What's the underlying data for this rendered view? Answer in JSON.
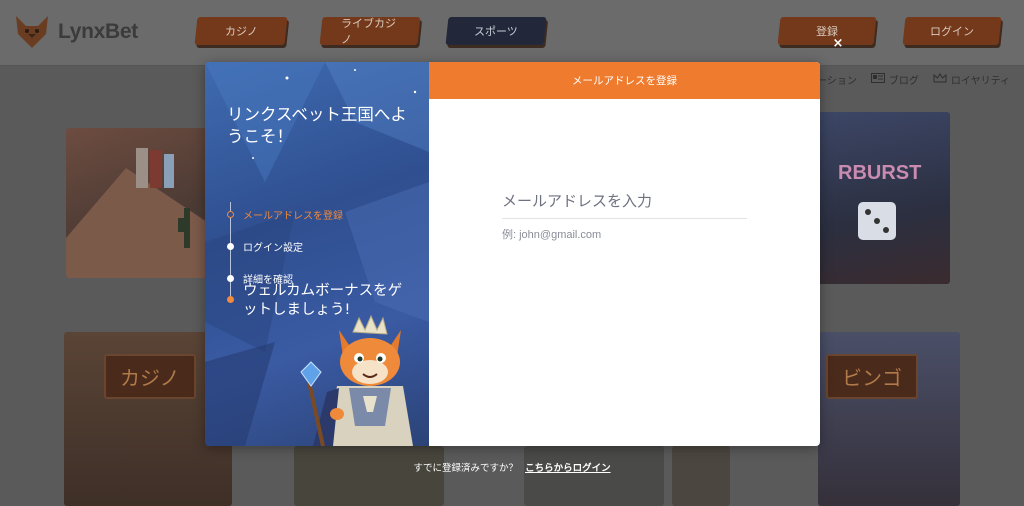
{
  "header": {
    "logo_text": "LynxBet",
    "nav": [
      "カジノ",
      "ライブカジノ",
      "スポーツ"
    ],
    "register_label": "登録",
    "login_label": "ログイン"
  },
  "subnav": {
    "promotion_partial": "ーション",
    "blog": "ブログ",
    "loyalty": "ロイヤリティ"
  },
  "background": {
    "casino_label": "カジノ",
    "bingo_label": "ビンゴ",
    "starburst_partial": "RBURST"
  },
  "modal": {
    "welcome_title": "リンクスベット王国へようこそ！",
    "steps": [
      {
        "label": "メールアドレスを登録",
        "active": true
      },
      {
        "label": "ログイン設定",
        "active": false
      },
      {
        "label": "詳細を確認",
        "active": false
      }
    ],
    "promo_text": "ウェルカムボーナスをゲットしましょう!",
    "form_header": "メールアドレスを登録",
    "email_label": "メールアドレスを入力",
    "email_placeholder": "例: john@gmail.com",
    "email_value": ""
  },
  "close_label": "×",
  "footer": {
    "already_text": "すでに登録済みですか？",
    "login_link": "こちらからログイン"
  },
  "colors": {
    "accent": "#ef7b2e",
    "modal_left_bg": "#2f4f90",
    "overlay_bg": "#5a5a5a"
  }
}
